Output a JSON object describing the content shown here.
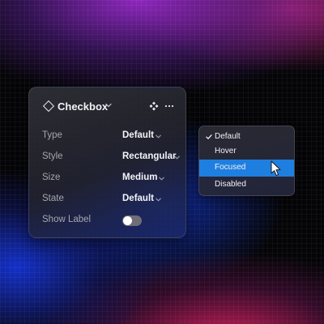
{
  "panel": {
    "title": "Checkbox",
    "rows": [
      {
        "label": "Type",
        "value": "Default"
      },
      {
        "label": "Style",
        "value": "Rectangular"
      },
      {
        "label": "Size",
        "value": "Medium"
      },
      {
        "label": "State",
        "value": "Default"
      }
    ],
    "show_label": {
      "label": "Show Label",
      "on": false
    }
  },
  "dropdown": {
    "options": [
      "Default",
      "Hover",
      "Focused",
      "Disabled"
    ],
    "checked": "Default",
    "highlighted": "Focused"
  },
  "colors": {
    "highlight": "#1f7fe0",
    "toggle_off": "#6e6e78"
  },
  "icons": [
    "diamond-icon",
    "chevron-down-icon",
    "component-icon",
    "more-icon",
    "check-icon",
    "cursor-icon"
  ]
}
